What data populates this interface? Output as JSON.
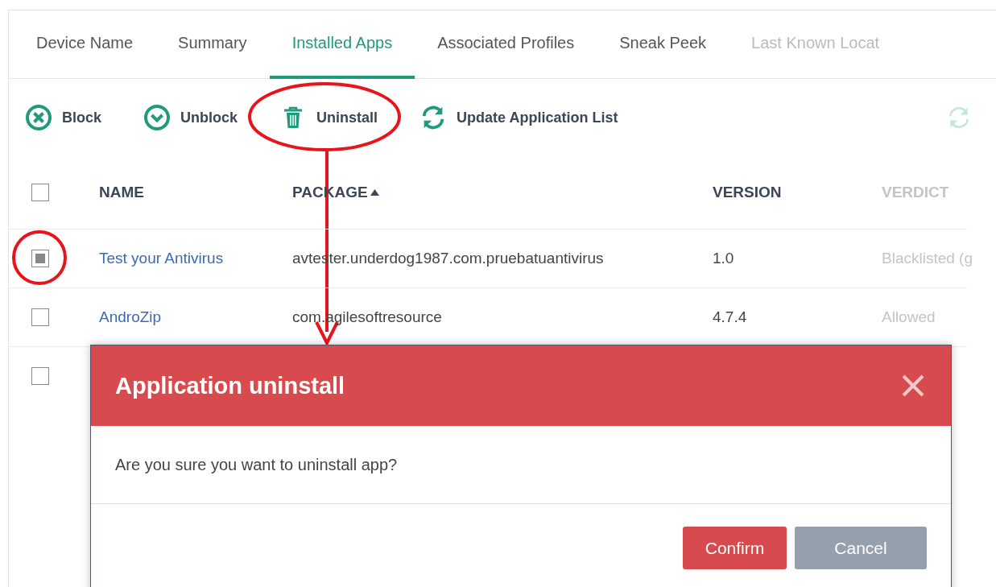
{
  "tabs": [
    {
      "label": "Device Name",
      "selected": false,
      "faded": false
    },
    {
      "label": "Summary",
      "selected": false,
      "faded": false
    },
    {
      "label": "Installed Apps",
      "selected": true,
      "faded": false
    },
    {
      "label": "Associated Profiles",
      "selected": false,
      "faded": false
    },
    {
      "label": "Sneak Peek",
      "selected": false,
      "faded": false
    },
    {
      "label": "Last Known Locat",
      "selected": false,
      "faded": true
    }
  ],
  "toolbar": [
    {
      "kind": "block",
      "label": "Block"
    },
    {
      "kind": "unblock",
      "label": "Unblock"
    },
    {
      "kind": "uninstall",
      "label": "Uninstall"
    },
    {
      "kind": "update",
      "label": "Update Application List"
    }
  ],
  "table": {
    "select_all_checked": false,
    "columns": [
      {
        "label": "NAME",
        "sorted": false,
        "faded": false
      },
      {
        "label": "PACKAGE",
        "sorted": true,
        "faded": false
      },
      {
        "label": "VERSION",
        "sorted": false,
        "faded": false
      },
      {
        "label": "VERDICT",
        "sorted": false,
        "faded": true
      }
    ],
    "rows": [
      {
        "checked": true,
        "name": "Test your Antivirus",
        "package": "avtester.underdog1987.com.pruebatuantivirus",
        "version": "1.0",
        "verdict": "Blacklisted (g"
      },
      {
        "checked": false,
        "name": "AndroZip",
        "package": "com.agilesoftresource",
        "version": "4.7.4",
        "verdict": "Allowed"
      },
      {
        "checked": false
      }
    ]
  },
  "dialog": {
    "title": "Application uninstall",
    "message": "Are you sure you want to uninstall app?",
    "buttons": [
      {
        "kind": "primary",
        "label": "Confirm"
      },
      {
        "kind": "secondary",
        "label": "Cancel"
      }
    ]
  }
}
